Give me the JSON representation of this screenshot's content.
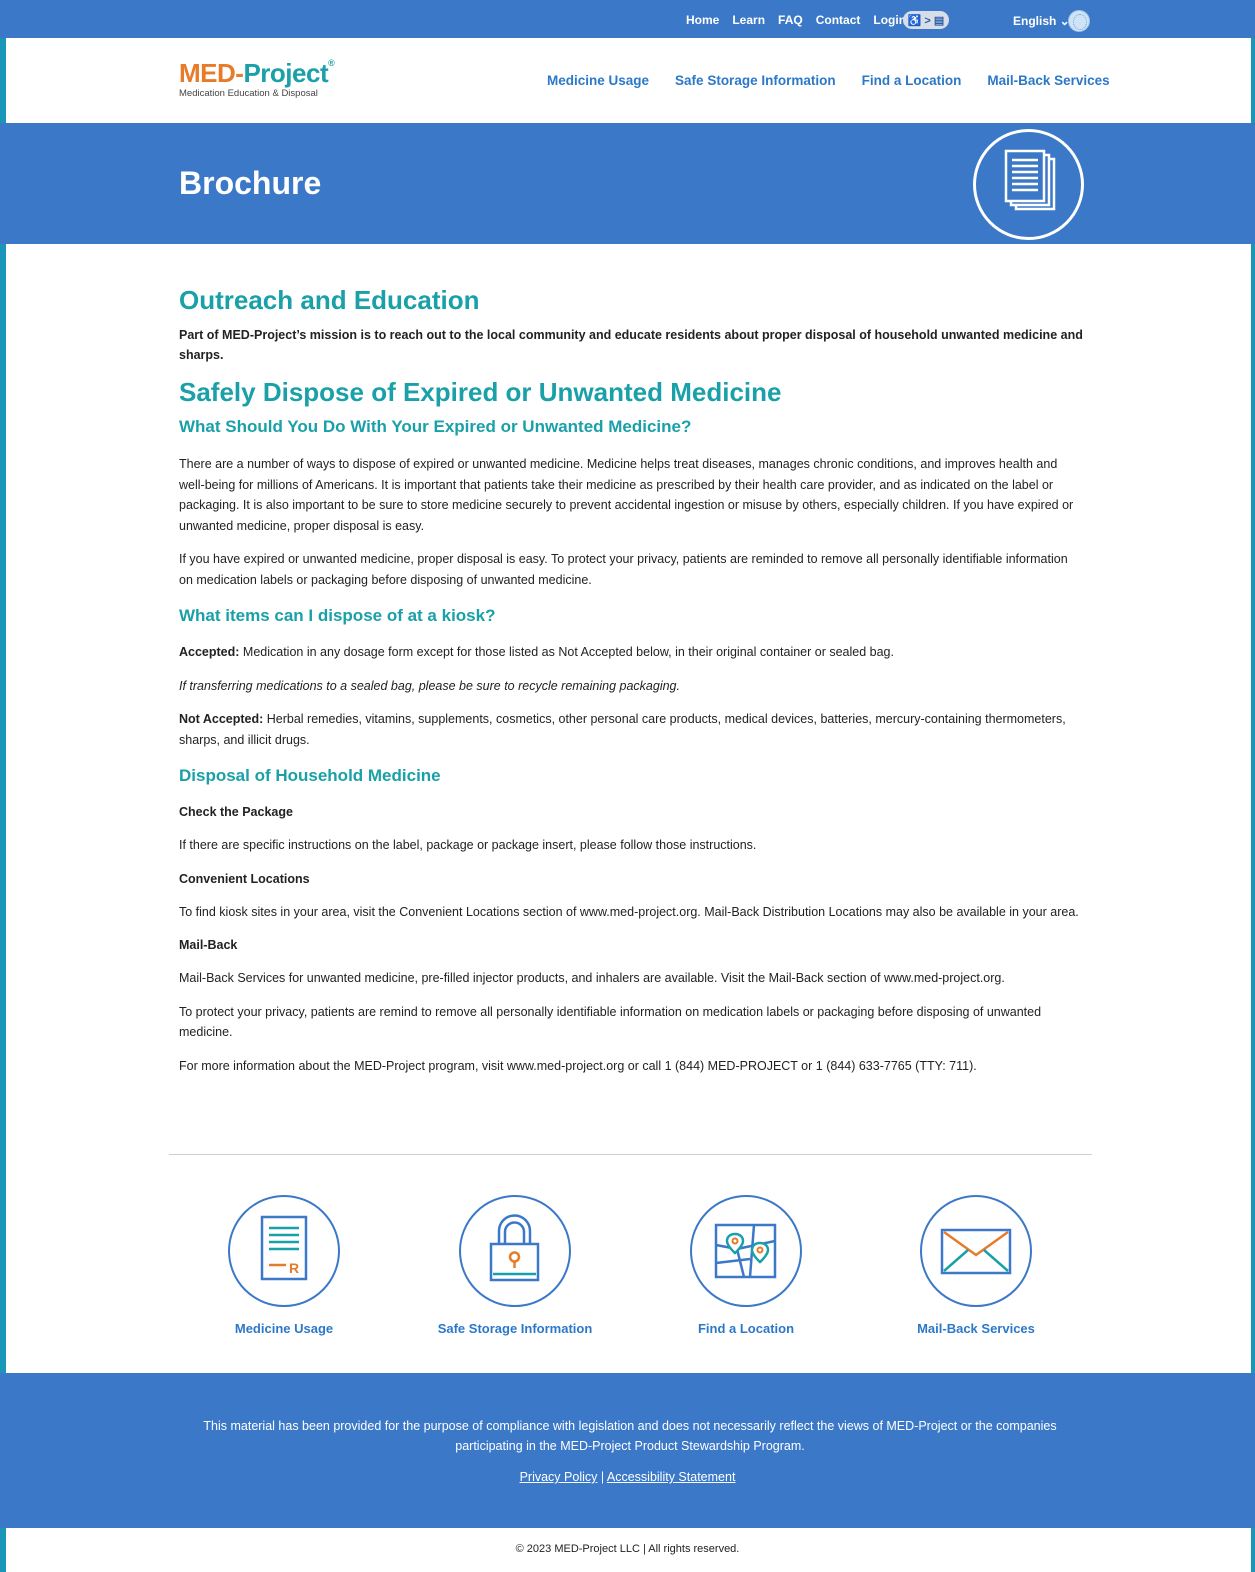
{
  "utility_bar": {
    "links": [
      "Home",
      "Learn",
      "FAQ",
      "Contact",
      "Login"
    ],
    "accessibility_toggle": "♿ > ▤",
    "language": "English ⌄"
  },
  "header": {
    "logo_med": "MED",
    "logo_dash": "-",
    "logo_project": "Project",
    "logo_reg": "®",
    "logo_tagline": "Medication Education & Disposal",
    "nav": [
      "Medicine Usage",
      "Safe Storage Information",
      "Find a Location",
      "Mail-Back Services"
    ]
  },
  "banner": {
    "title": "Brochure",
    "icon": "document-stack-icon"
  },
  "content": {
    "outreach_title": "Outreach and Education",
    "outreach_lead": "Part of MED-Project’s mission is to reach out to the local community and educate residents about proper disposal of household unwanted medicine and sharps.",
    "dispose_title": "Safely Dispose of Expired or Unwanted Medicine",
    "what_title": "What Should You Do With Your Expired or Unwanted Medicine?",
    "what_p1": "There are a number of ways to dispose of expired or unwanted medicine. Medicine helps treat diseases, manages chronic conditions, and improves health and well-being for millions of Americans. It is important that patients take their medicine as prescribed by their health care provider, and as indicated on the label or packaging. It is also important to be sure to store medicine securely to prevent accidental ingestion or misuse by others, especially children. If you have expired or unwanted medicine, proper disposal is easy.",
    "what_p2": "If you have expired or unwanted medicine, proper disposal is easy. To protect your privacy, patients are reminded to remove all personally identifiable information on medication labels or packaging before disposing of unwanted medicine.",
    "kiosk_title": "What items can I dispose of at a kiosk?",
    "accepted_label": "Accepted:",
    "accepted_text": " Medication in any dosage form except for those listed as Not Accepted below, in their original container or sealed bag.",
    "transfer_note": "If transferring medications to a sealed bag, please be sure to recycle remaining packaging.",
    "not_accepted_label": "Not Accepted:",
    "not_accepted_text": " Herbal remedies, vitamins, supplements, cosmetics, other personal care products, medical devices, batteries, mercury-containing thermometers, sharps, and illicit drugs.",
    "household_title": "Disposal of Household Medicine",
    "check_label": "Check the Package",
    "check_text": "If there are specific instructions on the label, package or package insert, please follow those instructions.",
    "locations_label": "Convenient Locations",
    "locations_text": "To find kiosk sites in your area, visit the Convenient Locations section of www.med-project.org. Mail-Back Distribution Locations may also be available in your area.",
    "mailback_label": "Mail-Back",
    "mailback_text": "Mail-Back Services for unwanted medicine, pre-filled injector products, and inhalers are available. Visit the Mail-Back section of www.med-project.org.",
    "privacy_text": "To protect your privacy, patients are remind to remove all personally identifiable information on medication labels or packaging before disposing of unwanted medicine.",
    "more_info_text": "For more information about the MED-Project program, visit www.med-project.org or call 1 (844) MED-PROJECT or 1 (844) 633-7765 (TTY: 711)."
  },
  "features": [
    {
      "label": "Medicine Usage",
      "icon": "prescription-document-icon"
    },
    {
      "label": "Safe Storage Information",
      "icon": "padlock-icon"
    },
    {
      "label": "Find a Location",
      "icon": "map-pin-icon"
    },
    {
      "label": "Mail-Back Services",
      "icon": "envelope-icon"
    }
  ],
  "footer": {
    "disclaimer": "This material has been provided for the purpose of compliance with legislation and does not necessarily reflect the views of MED-Project or the companies participating in the MED-Project Product Stewardship Program.",
    "privacy_link": "Privacy Policy",
    "separator": " | ",
    "accessibility_link": "Accessibility Statement",
    "copyright": "©  2023 MED-Project LLC | All rights reserved."
  },
  "colors": {
    "brand_blue": "#3b78c8",
    "teal": "#1aa0a8",
    "orange": "#e87b2a"
  }
}
